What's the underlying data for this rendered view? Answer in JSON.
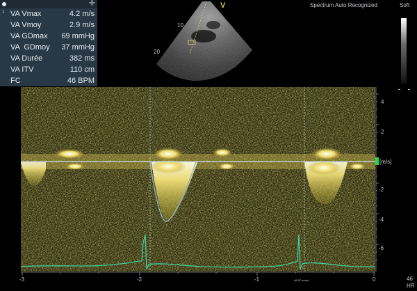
{
  "measurements": {
    "index": "1",
    "rows": [
      {
        "label": "VA Vmax",
        "value": "4.2 m/s"
      },
      {
        "label": "VA Vmoy",
        "value": "2.9 m/s"
      },
      {
        "label": "VA GDmax",
        "value": "69 mmHg"
      },
      {
        "label": "VA  GDmoy",
        "value": "37 mmHg"
      },
      {
        "label": "VA Durée",
        "value": "382 ms"
      },
      {
        "label": "VA ITV",
        "value": "110 cm"
      },
      {
        "label": "FC",
        "value": "46 BPM"
      }
    ]
  },
  "sector": {
    "cursor_label": "V",
    "depths": [
      "10",
      "20"
    ]
  },
  "status": "Spectrum Auto Recognized",
  "grayscale_label": "Soft",
  "velocity_scale": {
    "unit": "[m/s]",
    "ticks": [
      "4",
      "2",
      "-2",
      "-4",
      "-6"
    ]
  },
  "time_axis": {
    "ticks": [
      "-3",
      "-2",
      "-1",
      "0"
    ]
  },
  "heart_rate": {
    "value": "46",
    "label": "HR"
  },
  "ecg_note": "46.67 mm/s",
  "colors": {
    "panel": "#283845",
    "spectrum": "#e9d23c",
    "trace": "#8fb3c8",
    "ecg": "#3fd09a",
    "baseline": "#c9e6f0",
    "marker": "#2bd150"
  }
}
